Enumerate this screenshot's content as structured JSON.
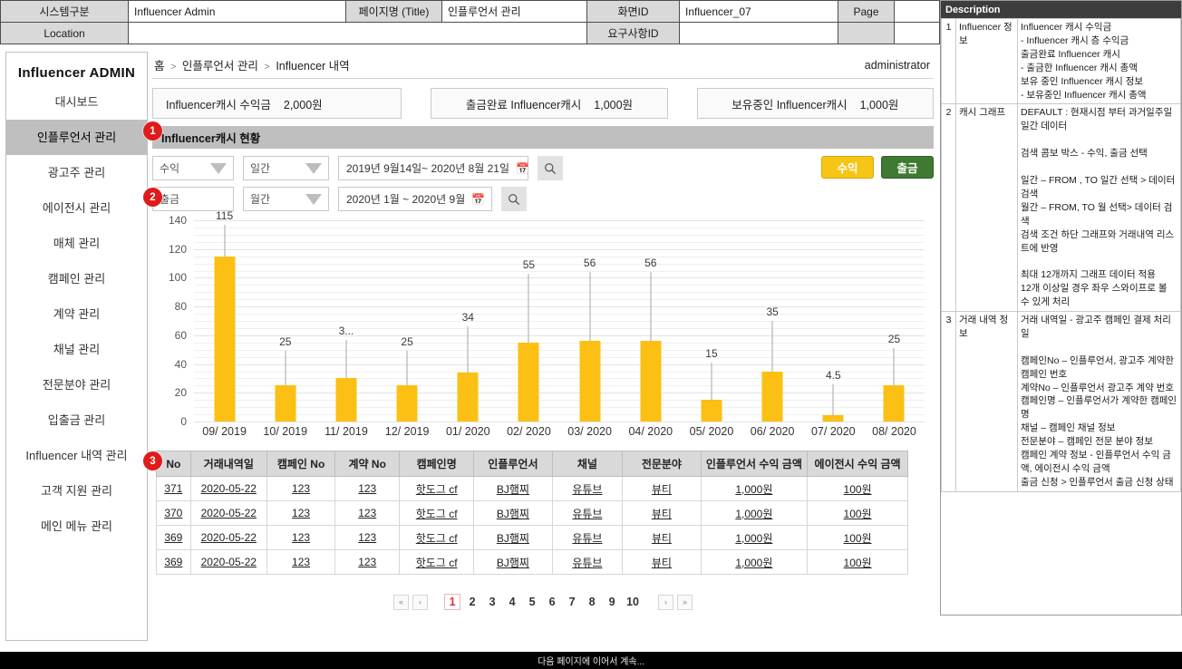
{
  "spec": {
    "row1": [
      {
        "label": "시스템구분",
        "value": "Influencer Admin"
      },
      {
        "label": "페이지명 (Title)",
        "value": "인플루언서 관리"
      },
      {
        "label": "화면ID",
        "value": "Influencer_07"
      },
      {
        "label": "Page",
        "value": ""
      }
    ],
    "row2": [
      {
        "label": "Location",
        "value": ""
      },
      {
        "label": "요구사항ID",
        "value": ""
      }
    ]
  },
  "sidebar": {
    "brand": "Influencer ADMIN",
    "items": [
      {
        "label": "대시보드",
        "active": false
      },
      {
        "label": "인플루언서 관리",
        "active": true
      },
      {
        "label": "광고주 관리",
        "active": false
      },
      {
        "label": "에이전시 관리",
        "active": false
      },
      {
        "label": "매체 관리",
        "active": false
      },
      {
        "label": "캠페인 관리",
        "active": false
      },
      {
        "label": "계약 관리",
        "active": false
      },
      {
        "label": "채널 관리",
        "active": false
      },
      {
        "label": "전문분야 관리",
        "active": false
      },
      {
        "label": "입출금 관리",
        "active": false
      },
      {
        "label": "Influencer 내역 관리",
        "active": false
      },
      {
        "label": "고객 지원 관리",
        "active": false
      },
      {
        "label": "메인 메뉴 관리",
        "active": false
      }
    ]
  },
  "breadcrumb": {
    "home": "홈",
    "level2": "인플루언서 관리",
    "level3": "Influencer 내역",
    "separator": ">",
    "user": "administrator"
  },
  "cards": [
    {
      "label": "Influencer캐시 수익금",
      "amount": "2,000원"
    },
    {
      "label": "출금완료 Influencer캐시",
      "amount": "1,000원"
    },
    {
      "label": "보유중인 Influencer캐시",
      "amount": "1,000원"
    }
  ],
  "section": {
    "title": "Influencer캐시 현황"
  },
  "filters": {
    "row1": {
      "type_select": "수익",
      "period_select": "일간",
      "date_range": "2019년 9월14일~ 2020년 8월 21일",
      "search_icon": "search-icon"
    },
    "row2": {
      "type_select": "출금",
      "period_select": "월간",
      "date_range": "2020년 1월 ~ 2020년 9월",
      "search_icon": "search-icon"
    },
    "buttons": [
      {
        "label": "수익",
        "color": "#f5c518"
      },
      {
        "label": "출금",
        "color": "#3e7a32"
      }
    ]
  },
  "chart_data": {
    "type": "bar",
    "title": "",
    "xlabel": "",
    "ylabel": "",
    "ylim": [
      0,
      140
    ],
    "yticks": [
      0,
      20,
      40,
      60,
      80,
      100,
      120,
      140
    ],
    "grid": true,
    "legend": null,
    "bar_color": "#fbc013",
    "categories": [
      "09/ 2019",
      "10/ 2019",
      "11/ 2019",
      "12/ 2019",
      "01/ 2020",
      "02/ 2020",
      "03/ 2020",
      "04/ 2020",
      "05/ 2020",
      "06/ 2020",
      "07/ 2020",
      "08/ 2020"
    ],
    "values": [
      115,
      25,
      30,
      25,
      34,
      55,
      56,
      56,
      15,
      35,
      4.5,
      25
    ],
    "data_labels": [
      "115",
      "25",
      "3...",
      "25",
      "34",
      "55",
      "56",
      "56",
      "15",
      "35",
      "4.5",
      "25"
    ],
    "label_heights": [
      137,
      49,
      57,
      49,
      66,
      103,
      104,
      104,
      41,
      70,
      26,
      51
    ]
  },
  "table": {
    "headers": [
      "No",
      "거래내역일",
      "캠페인 No",
      "계약 No",
      "캠페인명",
      "인플루언서",
      "채널",
      "전문분야",
      "인플루언서 수익 금액",
      "에이전시 수익 금액"
    ],
    "rows": [
      [
        "371",
        "2020-05-22",
        "123",
        "123",
        "핫도그 cf",
        "BJ햄찌",
        "유튜브",
        "뷰티",
        "1,000원",
        "100원"
      ],
      [
        "370",
        "2020-05-22",
        "123",
        "123",
        "핫도그 cf",
        "BJ햄찌",
        "유튜브",
        "뷰티",
        "1,000원",
        "100원"
      ],
      [
        "369",
        "2020-05-22",
        "123",
        "123",
        "핫도그 cf",
        "BJ햄찌",
        "유튜브",
        "뷰티",
        "1,000원",
        "100원"
      ],
      [
        "369",
        "2020-05-22",
        "123",
        "123",
        "핫도그 cf",
        "BJ햄찌",
        "유튜브",
        "뷰티",
        "1,000원",
        "100원"
      ]
    ]
  },
  "pagination": {
    "first": "«",
    "prev": "‹",
    "pages": [
      "1",
      "2",
      "3",
      "4",
      "5",
      "6",
      "7",
      "8",
      "9",
      "10"
    ],
    "current": "1",
    "next": "›",
    "last": "»"
  },
  "badges": [
    "1",
    "2",
    "3"
  ],
  "description": {
    "title": "Description",
    "rows": [
      {
        "no": "1",
        "name": "Influencer 정보",
        "body": "Influencer 캐시 수익금\n-      Influencer 캐시 층 수익금\n출금완료 Influencer 캐시\n-      출금한 Influencer 캐시 총액\n보유 중인 Influencer 캐시 정보\n- 보유중인 Influencer 캐시 총액"
      },
      {
        "no": "2",
        "name": "캐시 그래프",
        "body": "DEFAULT : 현재시점 부터 과거일주일 일간 데이터\n\n검색 콤보 박스 - 수익, 출금 선택\n\n일간 –  FROM , TO 일간 선택 > 데이터 검색\n월간 – FROM, TO 월 선택> 데이터 검색\n검색 조건 하단 그래프와 거래내역 리스트에 반영\n\n최대 12개까지 그래프 데이터 적용\n12개 이상일 경우 좌우 스와이프로 볼 수 있게 처리"
      },
      {
        "no": "3",
        "name": "거래 내역 정보",
        "body": "거래 내역일  - 광고주 캠페인 결제 처리일\n\n캠페인No – 인플루언서, 광고주 계약한 캠페인 번호\n계약No – 인플루언서 광고주 계약 번호\n캠페인명 – 인플루언서가 계약한 캠페인명\n채널 – 캠페인 채널 정보\n전문분야 – 캠페인 전문 분야 정보\n캠페인 계약 정보 -  인플루언서 수익 금액, 에이전시 수익 금액\n출금 신청 > 인플루언서 출금 신청 상태"
      }
    ]
  },
  "footer": {
    "text": "다음 페이지에 이어서 계속..."
  }
}
